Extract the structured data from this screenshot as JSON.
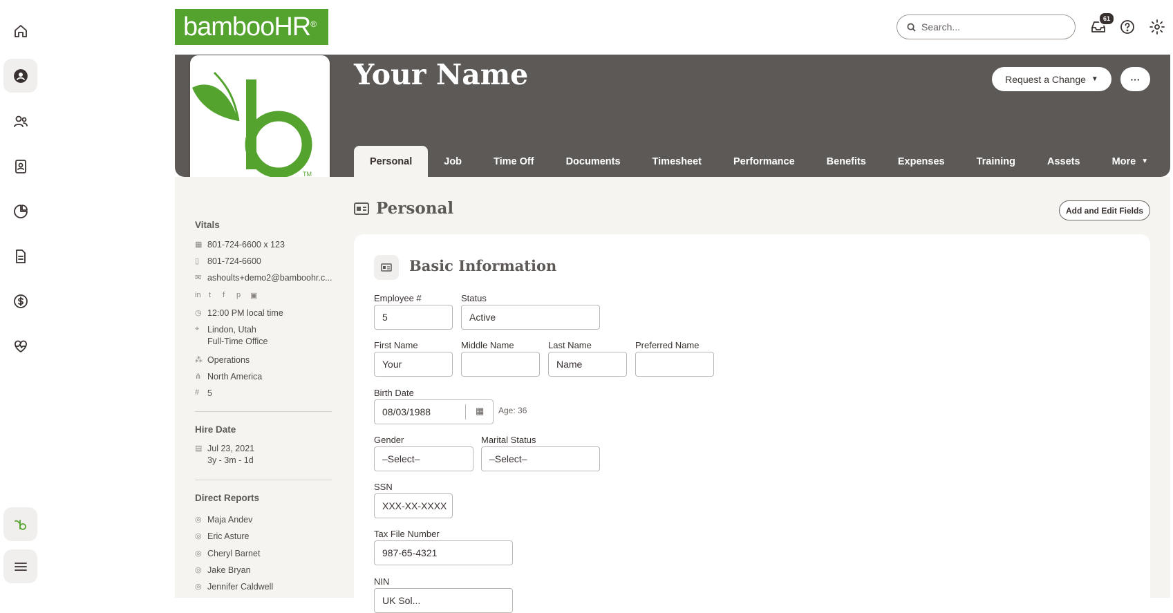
{
  "brand": {
    "logo_text": "bambooHR"
  },
  "search": {
    "placeholder": "Search..."
  },
  "notifications": {
    "count": "61"
  },
  "employee": {
    "name": "Your Name"
  },
  "header_actions": {
    "request_change": "Request a Change",
    "more": "···"
  },
  "tabs": [
    "Personal",
    "Job",
    "Time Off",
    "Documents",
    "Timesheet",
    "Performance",
    "Benefits",
    "Expenses",
    "Training",
    "Assets",
    "More"
  ],
  "sidebar": {
    "vitals_title": "Vitals",
    "work_phone": "801-724-6600 x 123",
    "mobile_phone": "801-724-6600",
    "email": "ashoults+demo2@bamboohr.c...",
    "local_time": "12:00 PM local time",
    "location": "Lindon, Utah",
    "office": "Full-Time Office",
    "department": "Operations",
    "division": "North America",
    "employee_number": "5",
    "hire_date_title": "Hire Date",
    "hire_date": "Jul 23, 2021",
    "tenure": "3y - 3m - 1d",
    "direct_reports_title": "Direct Reports",
    "direct_reports": [
      "Maja Andev",
      "Eric Asture",
      "Cheryl Barnet",
      "Jake Bryan",
      "Jennifer Caldwell"
    ]
  },
  "section": {
    "title": "Personal",
    "add_edit": "Add and Edit Fields"
  },
  "basic_info": {
    "title": "Basic Information",
    "employee_no_label": "Employee #",
    "employee_no": "5",
    "status_label": "Status",
    "status": "Active",
    "first_name_label": "First Name",
    "first_name": "Your",
    "middle_name_label": "Middle Name",
    "middle_name": "",
    "last_name_label": "Last Name",
    "last_name": "Name",
    "preferred_name_label": "Preferred Name",
    "preferred_name": "",
    "birth_date_label": "Birth Date",
    "birth_date": "08/03/1988",
    "age": "Age: 36",
    "gender_label": "Gender",
    "gender": "–Select–",
    "marital_label": "Marital Status",
    "marital": "–Select–",
    "ssn_label": "SSN",
    "ssn": "XXX-XX-XXXX",
    "tfn_label": "Tax File Number",
    "tfn": "987-65-4321",
    "nin_label": "NIN",
    "nin": "UK Sol..."
  },
  "colors": {
    "brand_green": "#53a32e",
    "header_gray": "#5d5957"
  }
}
